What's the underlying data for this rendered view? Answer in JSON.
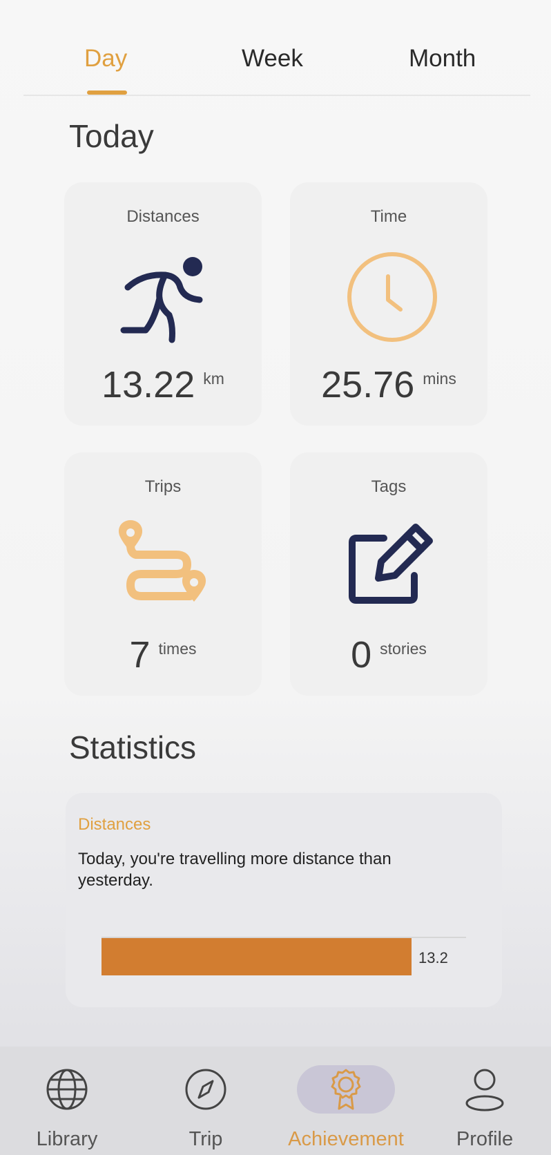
{
  "tabs": [
    {
      "label": "Day",
      "active": true
    },
    {
      "label": "Week",
      "active": false
    },
    {
      "label": "Month",
      "active": false
    }
  ],
  "today": {
    "title": "Today",
    "cards": {
      "distance": {
        "label": "Distances",
        "value": "13.22",
        "unit": "km",
        "icon": "running-person-icon"
      },
      "time": {
        "label": "Time",
        "value": "25.76",
        "unit": "mins",
        "icon": "clock-icon"
      },
      "trips": {
        "label": "Trips",
        "value": "7",
        "unit": "times",
        "icon": "route-icon"
      },
      "tags": {
        "label": "Tags",
        "value": "0",
        "unit": "stories",
        "icon": "edit-icon"
      }
    }
  },
  "statistics": {
    "title": "Statistics",
    "card": {
      "label": "Distances",
      "text": "Today, you're travelling more distance than yesterday.",
      "bar_value": "13.2",
      "bar_fraction": 0.85
    }
  },
  "bottom_nav": [
    {
      "label": "Library",
      "icon": "globe-icon",
      "active": false
    },
    {
      "label": "Trip",
      "icon": "compass-icon",
      "active": false
    },
    {
      "label": "Achievement",
      "icon": "award-icon",
      "active": true
    },
    {
      "label": "Profile",
      "icon": "person-icon",
      "active": false
    }
  ],
  "colors": {
    "accent": "#e0a040",
    "icon_light": "#f2c07e",
    "icon_dark": "#232a52",
    "bar": "#d27d30"
  }
}
